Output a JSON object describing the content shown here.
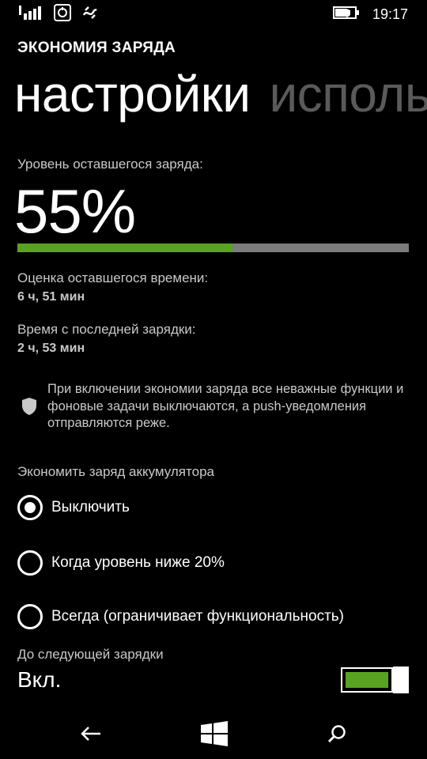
{
  "status_bar": {
    "time": "19:17",
    "signal_icon": "signal-bars-icon",
    "data_icon": "mobile-data-icon",
    "battery_saver_icon": "battery-saver-icon",
    "battery_icon": "battery-icon"
  },
  "app": {
    "title": "ЭКОНОМИЯ ЗАРЯДА"
  },
  "pivot": {
    "tabs": [
      {
        "label": "настройки",
        "active": true
      },
      {
        "label": "исполь",
        "active": false
      }
    ]
  },
  "battery": {
    "level_label": "Уровень оставшегося заряда:",
    "level_value": "55%",
    "level_fraction": 0.55,
    "time_left_label": "Оценка оставшегося времени:",
    "time_left_value": "6 ч, 51 мин",
    "since_charge_label": "Время с последней зарядки:",
    "since_charge_value": "2 ч, 53 мин",
    "fill_color": "#5aa322",
    "track_color": "#7c7c7c"
  },
  "info": {
    "icon": "shield-icon",
    "text": "При включении экономии заряда все неважные функции и фоновые задачи выключаются, а push-уведомления отправляются реже."
  },
  "saver": {
    "section_label": "Экономить заряд аккумулятора",
    "options": [
      {
        "label": "Выключить",
        "checked": true
      },
      {
        "label": "Когда уровень ниже 20%",
        "checked": false
      },
      {
        "label": "Всегда (ограничивает функциональность)",
        "checked": false
      }
    ]
  },
  "until_next_charge": {
    "label": "До следующей зарядки",
    "state": "Вкл.",
    "on": true,
    "accent_color": "#5aa322"
  },
  "navbar": {
    "back_icon": "back-arrow-icon",
    "start_icon": "windows-start-icon",
    "search_icon": "search-icon"
  }
}
